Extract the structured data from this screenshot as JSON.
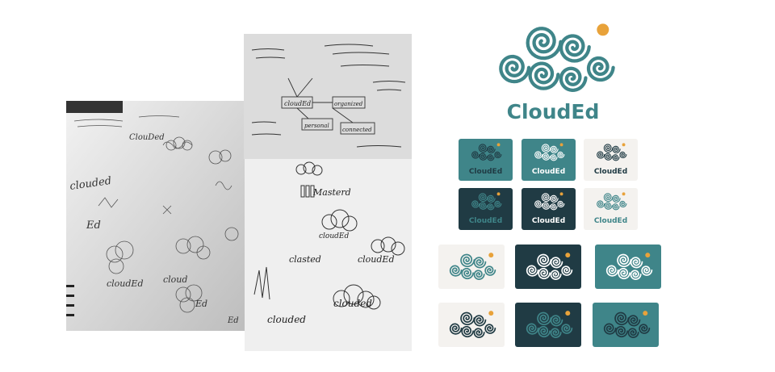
{
  "brand": {
    "name": "CloudEd",
    "colors": {
      "teal": "#3f8589",
      "dark": "#203b44",
      "orange": "#e8a23a",
      "cream": "#f4f2ef",
      "white": "#ffffff"
    }
  },
  "sketches": {
    "left_notebook": {
      "words": [
        "ClouDed",
        "clouded",
        "Ed",
        "cloudEd",
        "cloud",
        "Ed",
        "Ed"
      ]
    },
    "mindmap": {
      "words": [
        "cloudEd",
        "organized",
        "personal",
        "connected"
      ]
    },
    "right_page": {
      "words": [
        "Masterd",
        "cloudEd",
        "cloudEd",
        "clasted",
        "clouded",
        "clouded"
      ]
    }
  },
  "variants": [
    {
      "id": "teal-tile-dark-mark",
      "bg": "#3f8589",
      "fg": "#203b44",
      "label": "CloudEd",
      "labelColor": "#203b44",
      "labeled": true
    },
    {
      "id": "teal-tile-white-mark",
      "bg": "#3f8589",
      "fg": "#ffffff",
      "label": "CloudEd",
      "labelColor": "#ffffff",
      "labeled": true
    },
    {
      "id": "cream-tile-dark-mark",
      "bg": "#f4f2ef",
      "fg": "#203b44",
      "label": "CloudEd",
      "labelColor": "#203b44",
      "labeled": true
    },
    {
      "id": "dark-tile-teal-mark",
      "bg": "#203b44",
      "fg": "#3f8589",
      "label": "CloudEd",
      "labelColor": "#3f8589",
      "labeled": true
    },
    {
      "id": "dark-tile-white-mark",
      "bg": "#203b44",
      "fg": "#ffffff",
      "label": "CloudEd",
      "labelColor": "#ffffff",
      "labeled": true
    },
    {
      "id": "cream-tile-teal-mark",
      "bg": "#f4f2ef",
      "fg": "#3f8589",
      "label": "CloudEd",
      "labelColor": "#3f8589",
      "labeled": true
    },
    {
      "id": "cream-tile-teal-icon",
      "bg": "#f4f2ef",
      "fg": "#3f8589",
      "labeled": false
    },
    {
      "id": "dark-tile-white-icon",
      "bg": "#203b44",
      "fg": "#ffffff",
      "labeled": false
    },
    {
      "id": "teal-tile-white-icon",
      "bg": "#3f8589",
      "fg": "#ffffff",
      "labeled": false
    },
    {
      "id": "cream-tile-dark-icon",
      "bg": "#f4f2ef",
      "fg": "#203b44",
      "labeled": false
    },
    {
      "id": "dark-tile-teal-icon",
      "bg": "#203b44",
      "fg": "#3f8589",
      "labeled": false
    },
    {
      "id": "teal-tile-dark-icon",
      "bg": "#3f8589",
      "fg": "#203b44",
      "labeled": false
    }
  ]
}
